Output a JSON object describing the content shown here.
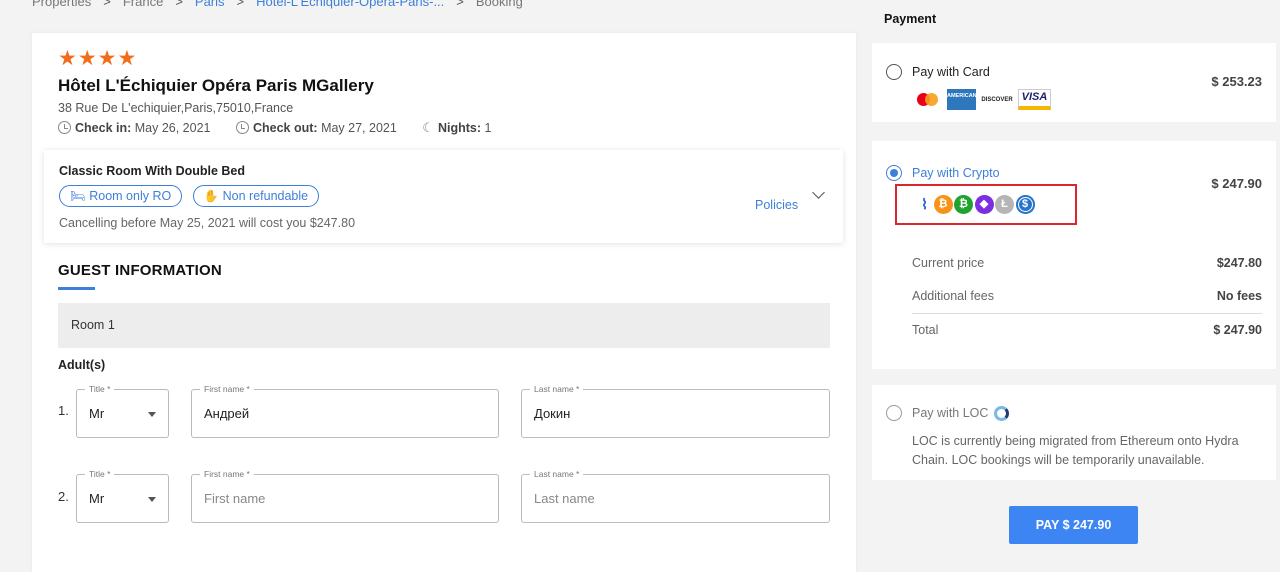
{
  "breadcrumb": [
    {
      "label": "Properties",
      "link": false
    },
    {
      "label": "France",
      "link": false
    },
    {
      "label": "Paris",
      "link": true
    },
    {
      "label": "Hotel-L'Echiquier-Opera-Paris-...",
      "link": true
    },
    {
      "label": "Booking",
      "link": false
    }
  ],
  "breadcrumb_separator": ">",
  "hotel": {
    "stars": "★★★★",
    "name": "Hôtel L'Échiquier Opéra Paris MGallery",
    "address": "38 Rue De L'echiquier,Paris,75010,France",
    "checkin_label": "Check in:",
    "checkin_value": "May 26, 2021",
    "checkout_label": "Check out:",
    "checkout_value": "May 27, 2021",
    "nights_label": "Nights:",
    "nights_value": "1",
    "moon_glyph": "☾"
  },
  "room": {
    "title": "Classic Room With Double Bed",
    "tags": [
      {
        "label": "Room only RO",
        "icon": "bed-icon",
        "glyph": "🛏"
      },
      {
        "label": "Non refundable",
        "icon": "hand-money-icon",
        "glyph": "✋"
      }
    ],
    "cancel_note": "Cancelling before May 25, 2021 will cost you $247.80",
    "policies_label": "Policies"
  },
  "guest": {
    "title": "GUEST INFORMATION",
    "room_label": "Room 1",
    "adults_label": "Adult(s)",
    "field_labels": {
      "title": "Title *",
      "first": "First name *",
      "last": "Last name *"
    },
    "rows": [
      {
        "num": "1.",
        "title": "Mr",
        "first": "Андрей",
        "last": "Докин",
        "first_placeholder": false,
        "last_placeholder": false
      },
      {
        "num": "2.",
        "title": "Mr",
        "first": "First name",
        "last": "Last name",
        "first_placeholder": true,
        "last_placeholder": true
      }
    ]
  },
  "payment": {
    "heading": "Payment",
    "card": {
      "label": "Pay with Card",
      "price": "$ 253.23",
      "logos": {
        "amex": "AMERICAN EXPRESS",
        "discover": "DISCOVER",
        "visa": "VISA"
      }
    },
    "crypto": {
      "label": "Pay with Crypto",
      "price": "$ 247.90",
      "icons": [
        {
          "name": "wallet-crypto-icon",
          "glyph": "⌇"
        },
        {
          "name": "bitcoin-icon",
          "glyph": "₿"
        },
        {
          "name": "bitcoin-cash-icon",
          "glyph": "₿"
        },
        {
          "name": "ethereum-icon",
          "glyph": "◆"
        },
        {
          "name": "litecoin-icon",
          "glyph": "Ł"
        },
        {
          "name": "usdc-icon",
          "glyph": "$"
        }
      ],
      "rows": [
        {
          "label": "Current price",
          "value": "$247.80"
        },
        {
          "label": "Additional fees",
          "value": "No fees"
        },
        {
          "label": "Total",
          "value": "$ 247.90"
        }
      ]
    },
    "loc": {
      "label": "Pay with LOC",
      "description": "LOC is currently being migrated from Ethereum onto Hydra Chain. LOC bookings will be temporarily unavailable."
    },
    "pay_button": "PAY $ 247.90"
  },
  "colors": {
    "accent": "#3d85f3",
    "star": "#f26c1a",
    "highlight_box": "#d9272e"
  }
}
